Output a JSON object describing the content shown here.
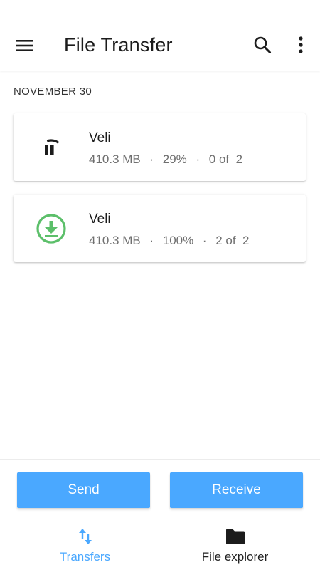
{
  "appbar": {
    "title": "File Transfer",
    "menu_icon": "hamburger-menu-icon",
    "search_icon": "search-icon",
    "more_icon": "more-vert-icon"
  },
  "section": {
    "header": "NOVEMBER 30"
  },
  "transfers": [
    {
      "name": "Veli",
      "size": "410.3 MB",
      "progress_label": "29%",
      "progress": 0.29,
      "files": "0 of  2",
      "separator": "·",
      "icon": "paused-progress-icon",
      "status": "paused"
    },
    {
      "name": "Veli",
      "size": "410.3 MB",
      "progress_label": "100%",
      "progress": 1.0,
      "files": "2 of  2",
      "separator": "·",
      "icon": "download-complete-icon",
      "status": "complete"
    }
  ],
  "actions": {
    "send": "Send",
    "receive": "Receive"
  },
  "bottom_nav": [
    {
      "label": "Transfers",
      "icon": "transfer-arrows-icon",
      "active": true
    },
    {
      "label": "File explorer",
      "icon": "folder-icon",
      "active": false
    }
  ],
  "colors": {
    "accent": "#4aa8ff",
    "success": "#5cbf6a",
    "text_secondary": "#6f6f6f"
  }
}
